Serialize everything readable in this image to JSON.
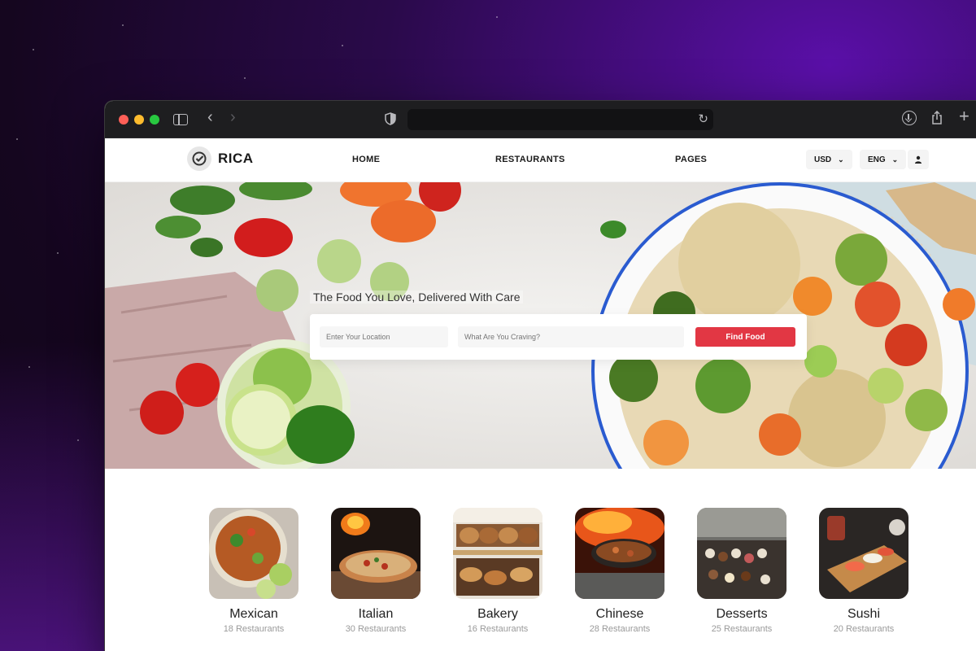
{
  "browser": {
    "url": ""
  },
  "nav": {
    "brand": "RICA",
    "links": [
      "HOME",
      "RESTAURANTS",
      "PAGES"
    ],
    "currency": "USD",
    "language": "ENG"
  },
  "hero": {
    "tagline": "The Food You Love, Delivered With Care",
    "location_placeholder": "Enter Your Location",
    "craving_placeholder": "What Are You Craving?",
    "cta": "Find Food"
  },
  "categories": [
    {
      "name": "Mexican",
      "count": "18 Restaurants"
    },
    {
      "name": "Italian",
      "count": "30 Restaurants"
    },
    {
      "name": "Bakery",
      "count": "16 Restaurants"
    },
    {
      "name": "Chinese",
      "count": "28 Restaurants"
    },
    {
      "name": "Desserts",
      "count": "25 Restaurants"
    },
    {
      "name": "Sushi",
      "count": "20 Restaurants"
    }
  ],
  "colors": {
    "accent": "#e23744",
    "backdrop": "#2a0a4a"
  },
  "icons": [
    "sidebar-icon",
    "back-icon",
    "forward-icon",
    "shield-icon",
    "reload-icon",
    "download-icon",
    "share-icon",
    "new-tab-icon",
    "check-badge-icon",
    "chevron-down-icon",
    "user-icon"
  ]
}
